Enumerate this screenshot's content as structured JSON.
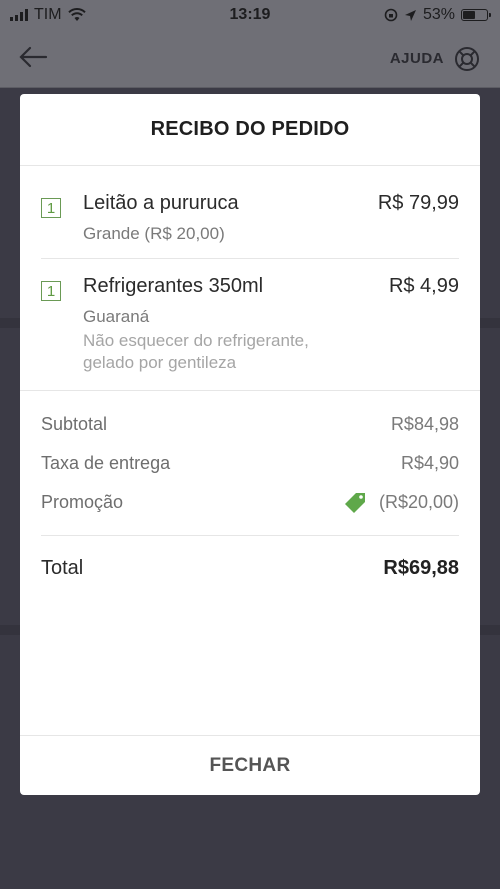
{
  "status_bar": {
    "carrier": "TIM",
    "time": "13:19",
    "battery": "53%",
    "battery_level": 0.53
  },
  "header": {
    "back_icon": "arrow-left-icon",
    "help_label": "AJUDA",
    "help_icon": "lifebuoy-icon"
  },
  "receipt": {
    "title": "RECIBO DO PEDIDO",
    "items": [
      {
        "qty": "1",
        "name": "Leitão a pururuca",
        "price": "R$ 79,99",
        "option": "Grande (R$ 20,00)",
        "note": ""
      },
      {
        "qty": "1",
        "name": "Refrigerantes 350ml",
        "price": "R$ 4,99",
        "option": "Guaraná",
        "note": "Não esquecer do refrigerante, gelado por gentileza"
      }
    ],
    "subtotal_label": "Subtotal",
    "subtotal_value": "R$84,98",
    "delivery_label": "Taxa de entrega",
    "delivery_value": "R$4,90",
    "promo_label": "Promoção",
    "promo_value": "(R$20,00)",
    "promo_icon": "price-tag-icon",
    "promo_color": "#5fa84a",
    "total_label": "Total",
    "total_value": "R$69,88",
    "close_label": "FECHAR"
  }
}
